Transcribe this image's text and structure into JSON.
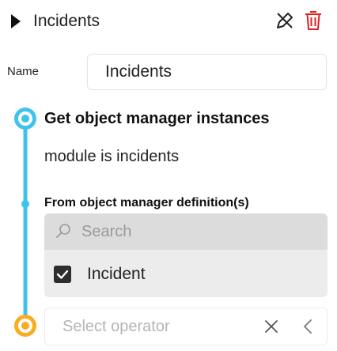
{
  "header": {
    "title": "Incidents",
    "icons": [
      "expand-triangle-icon",
      "edit-off-icon",
      "trash-icon"
    ]
  },
  "name_field": {
    "label": "Name",
    "value": "Incidents"
  },
  "step": {
    "title": "Get object manager instances",
    "description": "module is incidents"
  },
  "definitions": {
    "title": "From object manager definition(s)",
    "search_placeholder": "Search",
    "options": [
      {
        "label": "Incident",
        "checked": true
      }
    ]
  },
  "operator": {
    "placeholder": "Select operator"
  },
  "colors": {
    "timeline": "#3fc3ee",
    "end_node": "#f6ad1f",
    "danger": "#e02020"
  }
}
